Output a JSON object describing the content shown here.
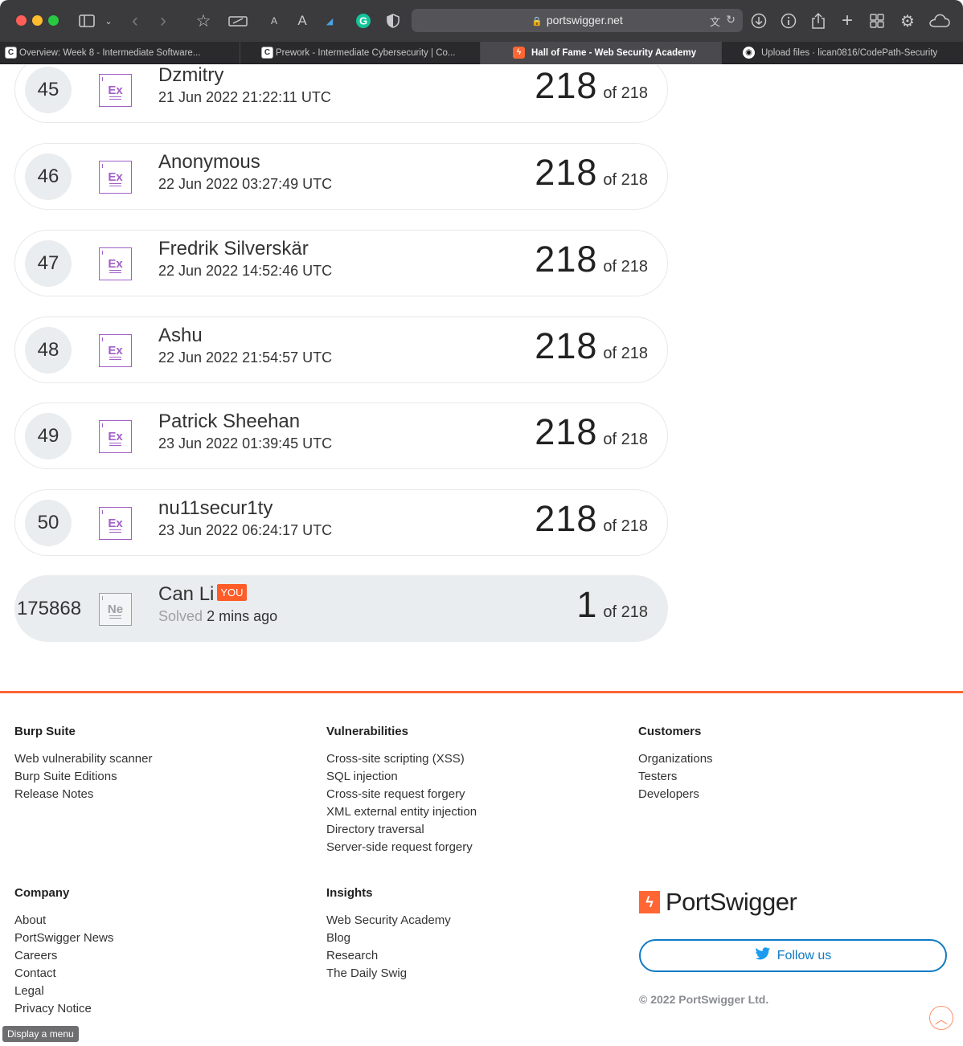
{
  "browser": {
    "url": "portswigger.net",
    "tabs": [
      {
        "title": "Overview: Week 8 - Intermediate Software...",
        "favicon": "C"
      },
      {
        "title": "Prework - Intermediate Cybersecurity | Co...",
        "favicon": "C"
      },
      {
        "title": "Hall of Fame - Web Security Academy",
        "favicon": "ϟ",
        "active": true
      },
      {
        "title": "Upload files · lican0816/CodePath-Security",
        "favicon": "◉"
      }
    ]
  },
  "leaderboard": {
    "rows": [
      {
        "rank": "45",
        "badge": "Ex",
        "name": "Dzmitry",
        "time": "21 Jun 2022 21:22:11 UTC",
        "score": "218",
        "of": "of 218"
      },
      {
        "rank": "46",
        "badge": "Ex",
        "name": "Anonymous",
        "time": "22 Jun 2022 03:27:49 UTC",
        "score": "218",
        "of": "of 218"
      },
      {
        "rank": "47",
        "badge": "Ex",
        "name": "Fredrik Silverskär",
        "time": "22 Jun 2022 14:52:46 UTC",
        "score": "218",
        "of": "of 218"
      },
      {
        "rank": "48",
        "badge": "Ex",
        "name": "Ashu",
        "time": "22 Jun 2022 21:54:57 UTC",
        "score": "218",
        "of": "of 218"
      },
      {
        "rank": "49",
        "badge": "Ex",
        "name": "Patrick Sheehan",
        "time": "23 Jun 2022 01:39:45 UTC",
        "score": "218",
        "of": "of 218"
      },
      {
        "rank": "50",
        "badge": "Ex",
        "name": "nu11secur1ty",
        "time": "23 Jun 2022 06:24:17 UTC",
        "score": "218",
        "of": "of 218"
      }
    ],
    "me": {
      "rank": "175868",
      "badge": "Ne",
      "name": "Can Li",
      "you_label": "YOU",
      "solved_label": "Solved",
      "solved_time": "2 mins ago",
      "score": "1",
      "of": "of 218"
    }
  },
  "footer": {
    "burp": {
      "heading": "Burp Suite",
      "links": [
        "Web vulnerability scanner",
        "Burp Suite Editions",
        "Release Notes"
      ]
    },
    "vulns": {
      "heading": "Vulnerabilities",
      "links": [
        "Cross-site scripting (XSS)",
        "SQL injection",
        "Cross-site request forgery",
        "XML external entity injection",
        "Directory traversal",
        "Server-side request forgery"
      ]
    },
    "customers": {
      "heading": "Customers",
      "links": [
        "Organizations",
        "Testers",
        "Developers"
      ]
    },
    "company": {
      "heading": "Company",
      "links": [
        "About",
        "PortSwigger News",
        "Careers",
        "Contact",
        "Legal",
        "Privacy Notice"
      ]
    },
    "insights": {
      "heading": "Insights",
      "links": [
        "Web Security Academy",
        "Blog",
        "Research",
        "The Daily Swig"
      ]
    },
    "logo_text": "PortSwigger",
    "follow_label": "Follow us",
    "copyright": "© 2022 PortSwigger Ltd."
  },
  "tooltip": "Display a menu",
  "colors": {
    "accent": "#ff6633",
    "expert_badge": "#a160c7",
    "twitter": "#0f7bc4",
    "you_badge": "#ff5c28"
  }
}
